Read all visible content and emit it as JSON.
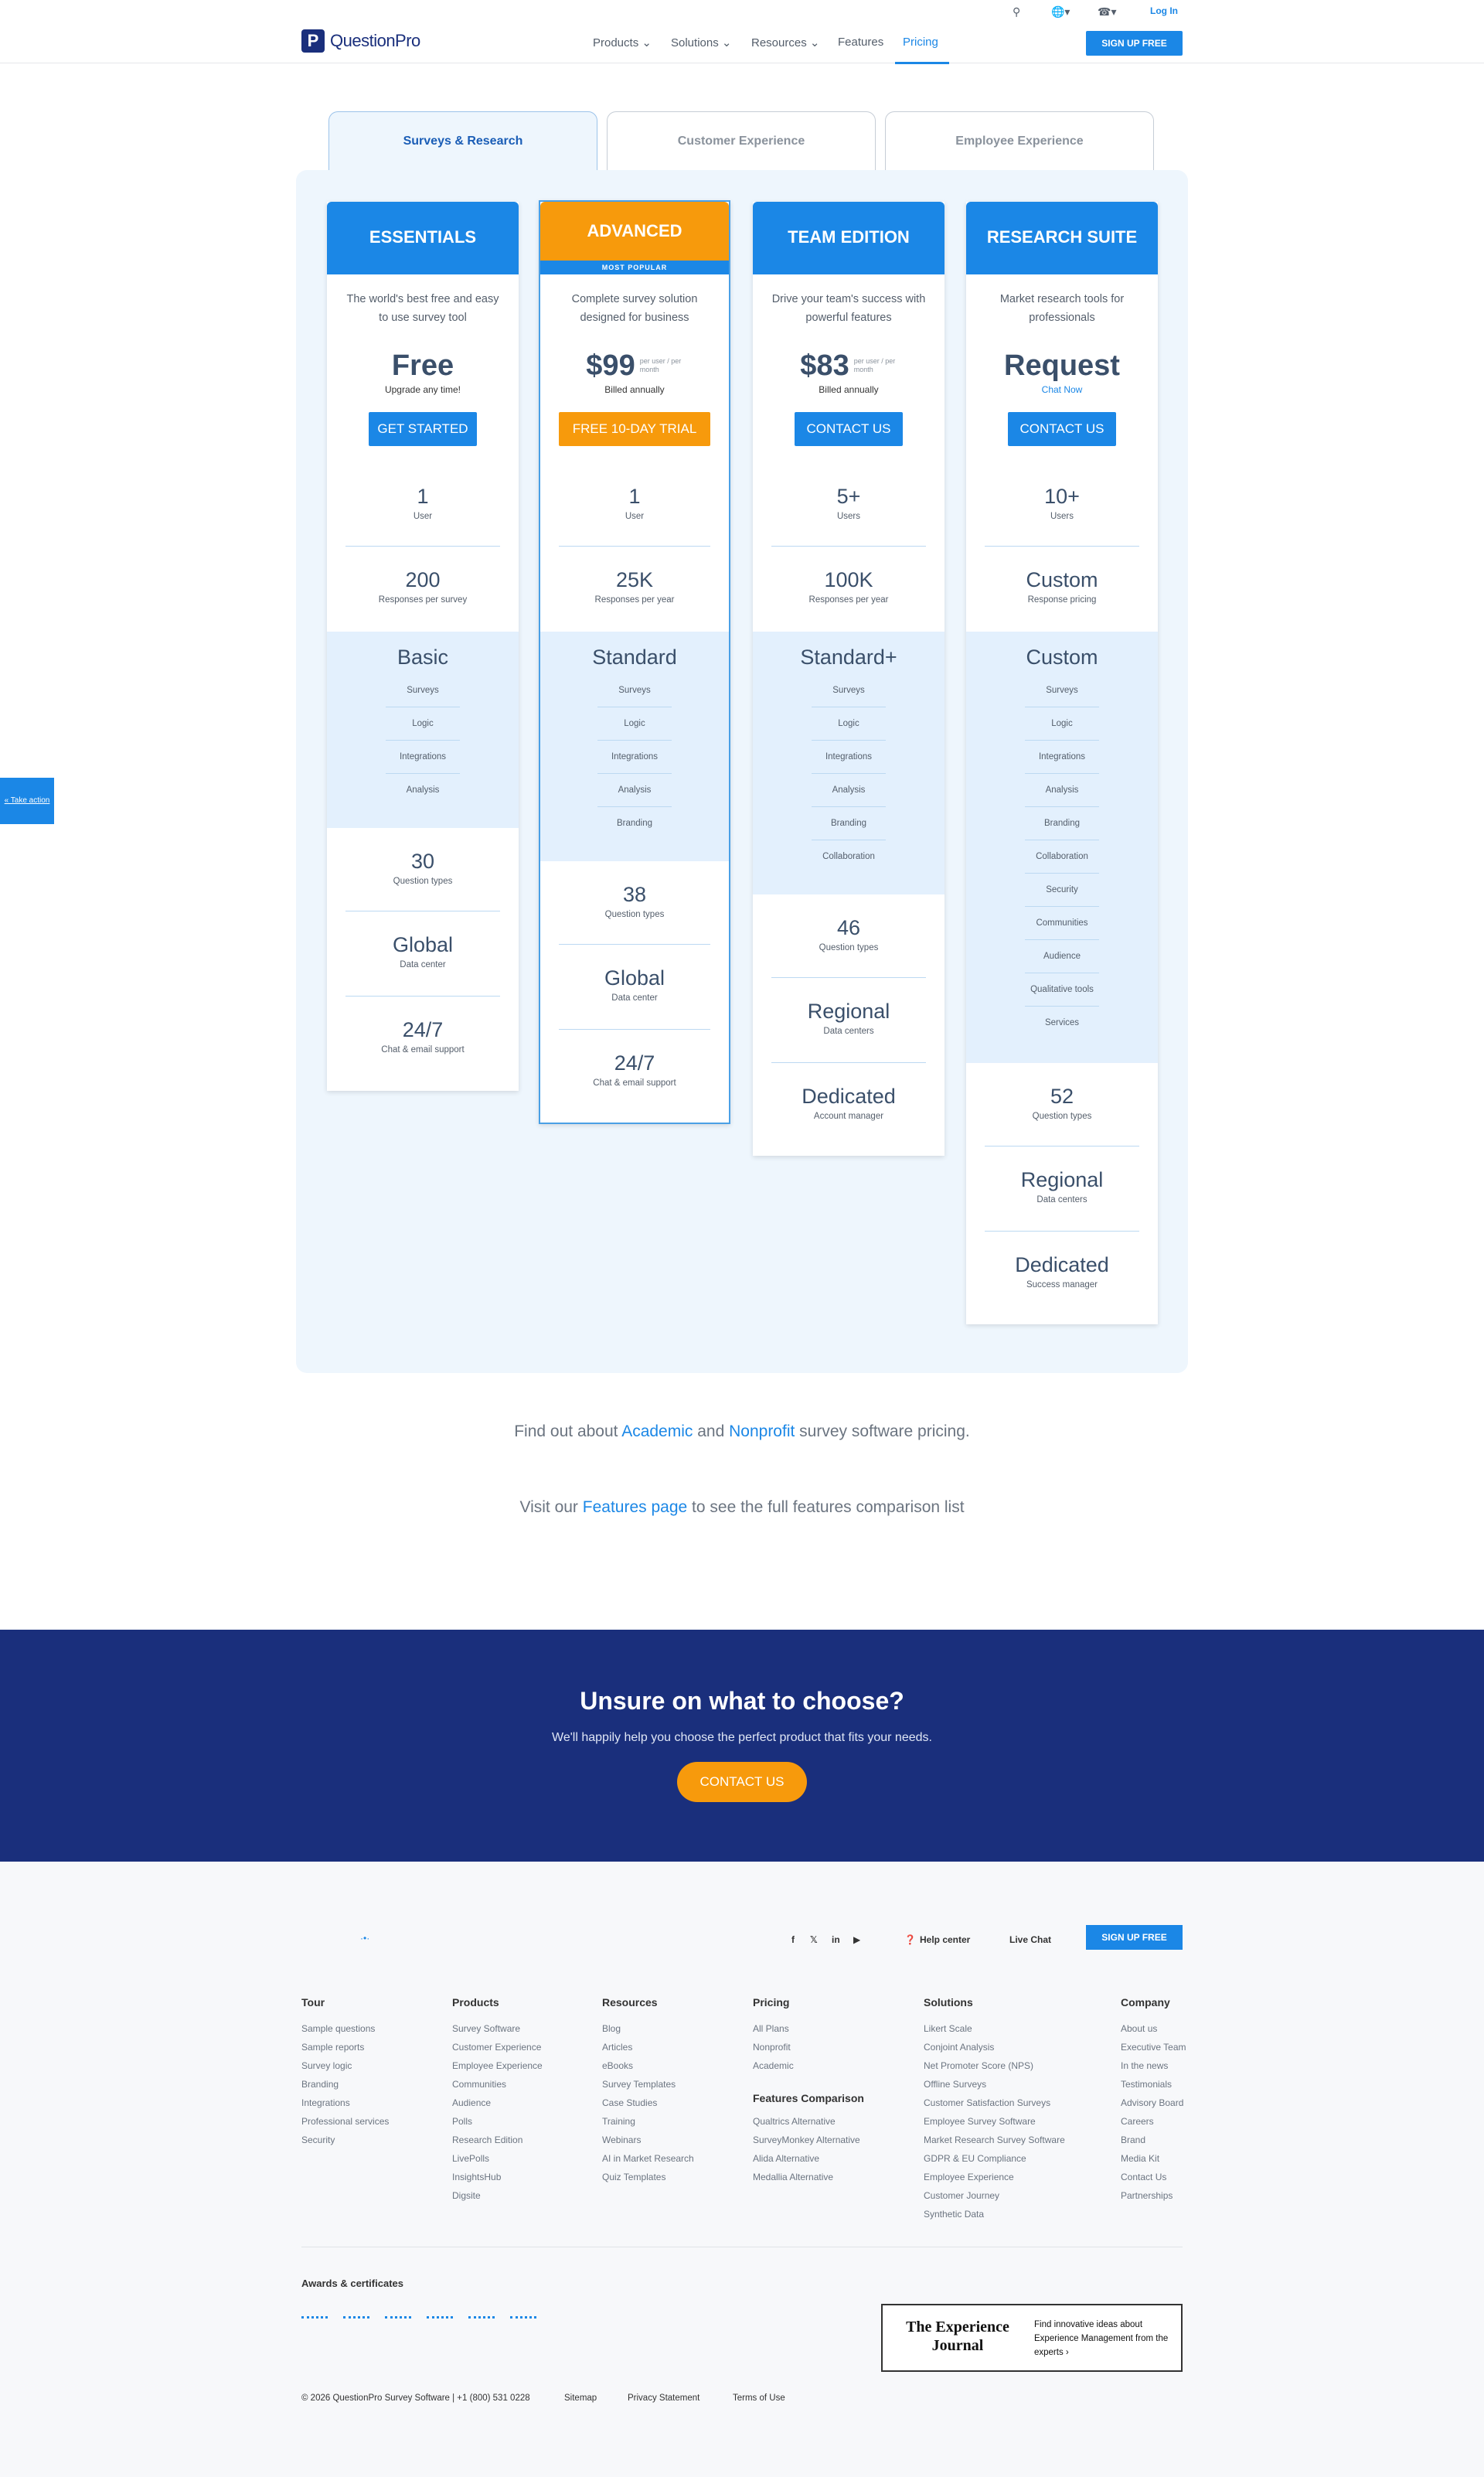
{
  "topbar": {
    "login": "Log In"
  },
  "header": {
    "logo_text": "QuestionPro",
    "logo_mark": "P",
    "nav": [
      "Products ⌄",
      "Solutions ⌄",
      "Resources ⌄",
      "Features",
      "Pricing"
    ],
    "signup": "SIGN UP FREE"
  },
  "tabs": [
    "Surveys & Research",
    "Customer Experience",
    "Employee Experience"
  ],
  "plans": {
    "essentials": {
      "name": "ESSENTIALS",
      "desc": "The world's best free and easy to use survey tool",
      "price": "Free",
      "price_unit": "",
      "sub": "Upgrade any time!",
      "cta": "GET STARTED",
      "stats": [
        {
          "v": "1",
          "l": "User"
        },
        {
          "v": "200",
          "l": "Responses per survey"
        }
      ],
      "tier": "Basic",
      "features": [
        "Surveys",
        "Logic",
        "Integrations",
        "Analysis"
      ],
      "extras": [
        {
          "v": "30",
          "l": "Question types"
        },
        {
          "v": "Global",
          "l": "Data center"
        },
        {
          "v": "24/7",
          "l": "Chat & email support"
        }
      ]
    },
    "advanced": {
      "name": "ADVANCED",
      "badge": "MOST POPULAR",
      "desc": "Complete survey solution designed for business",
      "price": "$99",
      "price_unit": "per user / per month",
      "sub": "Billed annually",
      "cta": "FREE 10-DAY TRIAL",
      "stats": [
        {
          "v": "1",
          "l": "User"
        },
        {
          "v": "25K",
          "l": "Responses per year"
        }
      ],
      "tier": "Standard",
      "features": [
        "Surveys",
        "Logic",
        "Integrations",
        "Analysis",
        "Branding"
      ],
      "extras": [
        {
          "v": "38",
          "l": "Question types"
        },
        {
          "v": "Global",
          "l": "Data center"
        },
        {
          "v": "24/7",
          "l": "Chat & email support"
        }
      ]
    },
    "team": {
      "name": "TEAM EDITION",
      "desc": "Drive your team's success with powerful features",
      "price": "$83",
      "price_unit": "per user / per month",
      "sub": "Billed annually",
      "cta": "CONTACT US",
      "stats": [
        {
          "v": "5+",
          "l": "Users"
        },
        {
          "v": "100K",
          "l": "Responses per year"
        }
      ],
      "tier": "Standard+",
      "features": [
        "Surveys",
        "Logic",
        "Integrations",
        "Analysis",
        "Branding",
        "Collaboration"
      ],
      "extras": [
        {
          "v": "46",
          "l": "Question types"
        },
        {
          "v": "Regional",
          "l": "Data centers"
        },
        {
          "v": "Dedicated",
          "l": "Account manager"
        }
      ]
    },
    "research": {
      "name": "RESEARCH SUITE",
      "desc": "Market research tools for professionals",
      "price": "Request",
      "price_unit": "",
      "sub": "Chat Now",
      "cta": "CONTACT US",
      "stats": [
        {
          "v": "10+",
          "l": "Users"
        },
        {
          "v": "Custom",
          "l": "Response pricing"
        }
      ],
      "tier": "Custom",
      "features": [
        "Surveys",
        "Logic",
        "Integrations",
        "Analysis",
        "Branding",
        "Collaboration",
        "Security",
        "Communities",
        "Audience",
        "Qualitative tools",
        "Services"
      ],
      "extras": [
        {
          "v": "52",
          "l": "Question types"
        },
        {
          "v": "Regional",
          "l": "Data centers"
        },
        {
          "v": "Dedicated",
          "l": "Success manager"
        }
      ]
    }
  },
  "info": {
    "l1_a": "Find out about ",
    "l1_b": "Academic",
    "l1_c": " and ",
    "l1_d": "Nonprofit",
    "l1_e": " survey software pricing.",
    "l2_a": "Visit our ",
    "l2_b": "Features page",
    "l2_c": " to see the full features comparison list"
  },
  "take_action": "« Take action",
  "banner": {
    "title": "Unsure on what to choose?",
    "text": "We'll happily help you choose the perfect product that fits your needs.",
    "button": "CONTACT US"
  },
  "footer": {
    "help": "Help center",
    "chat": "Live Chat",
    "signup": "SIGN UP FREE",
    "cols": [
      {
        "h": "Tour",
        "items": [
          "Sample questions",
          "Sample reports",
          "Survey logic",
          "Branding",
          "Integrations",
          "Professional services",
          "Security"
        ]
      },
      {
        "h": "Products",
        "items": [
          "Survey Software",
          "Customer Experience",
          "Employee Experience",
          "Communities",
          "Audience",
          "Polls",
          "Research Edition",
          "LivePolls",
          "InsightsHub",
          "Digsite"
        ]
      },
      {
        "h": "Resources",
        "items": [
          "Blog",
          "Articles",
          "eBooks",
          "Survey Templates",
          "Case Studies",
          "Training",
          "Webinars",
          "AI in Market Research",
          "Quiz Templates"
        ]
      },
      {
        "h": "Pricing",
        "items": [
          "All Plans",
          "Nonprofit",
          "Academic"
        ],
        "h2": "Features Comparison",
        "items2": [
          "Qualtrics Alternative",
          "SurveyMonkey Alternative",
          "Alida Alternative",
          "Medallia Alternative"
        ]
      },
      {
        "h": "Solutions",
        "items": [
          "Likert Scale",
          "Conjoint Analysis",
          "Net Promoter Score (NPS)",
          "Offline Surveys",
          "Customer Satisfaction Surveys",
          "Employee Survey Software",
          "Market Research Survey Software",
          "GDPR & EU Compliance",
          "Employee Experience",
          "Customer Journey",
          "Synthetic Data"
        ]
      },
      {
        "h": "Company",
        "items": [
          "About us",
          "Executive Team",
          "In the news",
          "Testimonials",
          "Advisory Board",
          "Careers",
          "Brand",
          "Media Kit",
          "Contact Us",
          "Partnerships"
        ]
      }
    ],
    "awards": "Awards & certificates",
    "ej_title": "The Experience Journal",
    "ej_text": "Find innovative ideas about Experience Management from the experts ›",
    "copyright": "© 2026 QuestionPro Survey Software | +1 (800) 531 0228",
    "sitemap": "Sitemap",
    "privacy": "Privacy Statement",
    "terms": "Terms of Use"
  }
}
